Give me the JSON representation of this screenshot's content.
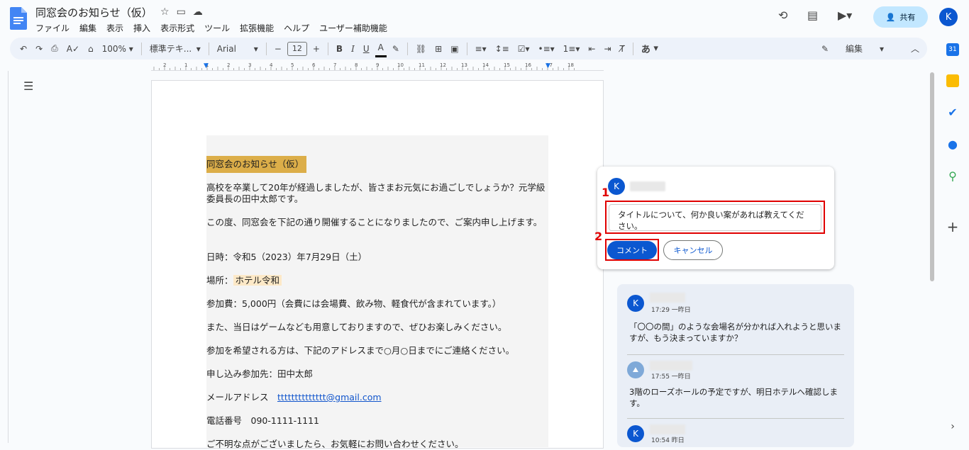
{
  "doc_title": "同窓会のお知らせ（仮）",
  "menus": [
    "ファイル",
    "編集",
    "表示",
    "挿入",
    "表示形式",
    "ツール",
    "拡張機能",
    "ヘルプ",
    "ユーザー補助機能"
  ],
  "share_label": "共有",
  "avatar_letter": "K",
  "toolbar": {
    "zoom": "100%",
    "style": "標準テキ...",
    "font": "Arial",
    "font_size": "12",
    "bold": "B",
    "italic": "I",
    "underline": "U",
    "text_color": "A",
    "input_tool": "あ",
    "mode": "編集"
  },
  "ruler_labels": [
    "2",
    "1",
    "1",
    "2",
    "3",
    "4",
    "5",
    "6",
    "7",
    "8",
    "9",
    "10",
    "11",
    "12",
    "13",
    "14",
    "15",
    "16",
    "17",
    "18"
  ],
  "document": {
    "title": "同窓会のお知らせ（仮）",
    "p1": "高校を卒業して20年が経過しましたが、皆さまお元気にお過ごしでしょうか？元学級委員長の田中太郎です。",
    "p2": "この度、同窓会を下記の通り開催することになりましたので、ご案内申し上げます。",
    "date": "日時：令和5（2023）年7月29日（土）",
    "place_label": " 場所：",
    "place_value": "ホテル令和",
    "fee": " 参加費：5,000円（会費には会場費、飲み物、軽食代が含まれています。）",
    "p3": "また、当日はゲームなども用意しておりますので、ぜひお楽しみください。",
    "p4": "参加を希望される方は、下記のアドレスまで○月○日までにご連絡ください。",
    "contact": "申し込み参加先：田中太郎",
    "email_label": "メールアドレス　",
    "email": "tttttttttttttt@gmail.com",
    "phone": "電話番号　090-1111-1111",
    "p5": "ご不明な点がございましたら、お気軽にお問い合わせください。"
  },
  "new_comment": {
    "avatar": "K",
    "text": "タイトルについて、何か良い案があれば教えてください。",
    "marker1": "1",
    "marker2": "2",
    "submit_label": "コメント",
    "cancel_label": "キャンセル"
  },
  "thread": [
    {
      "avatar": "K",
      "time": "17:29 一昨日",
      "text": "「〇〇の間」のような会場名が分かれば入れようと思いますが、もう決まっていますか？"
    },
    {
      "avatar": "",
      "time": "17:55 一昨日",
      "text": "3階のローズホールの予定ですが、明日ホテルへ確認します。"
    },
    {
      "avatar": "K",
      "time": "10:54 昨日",
      "text": ""
    }
  ],
  "colors": {
    "accent": "#0b57d0",
    "highlight_title": "#dcae49",
    "highlight_place": "#fde9c7",
    "annotation": "#e00000"
  }
}
